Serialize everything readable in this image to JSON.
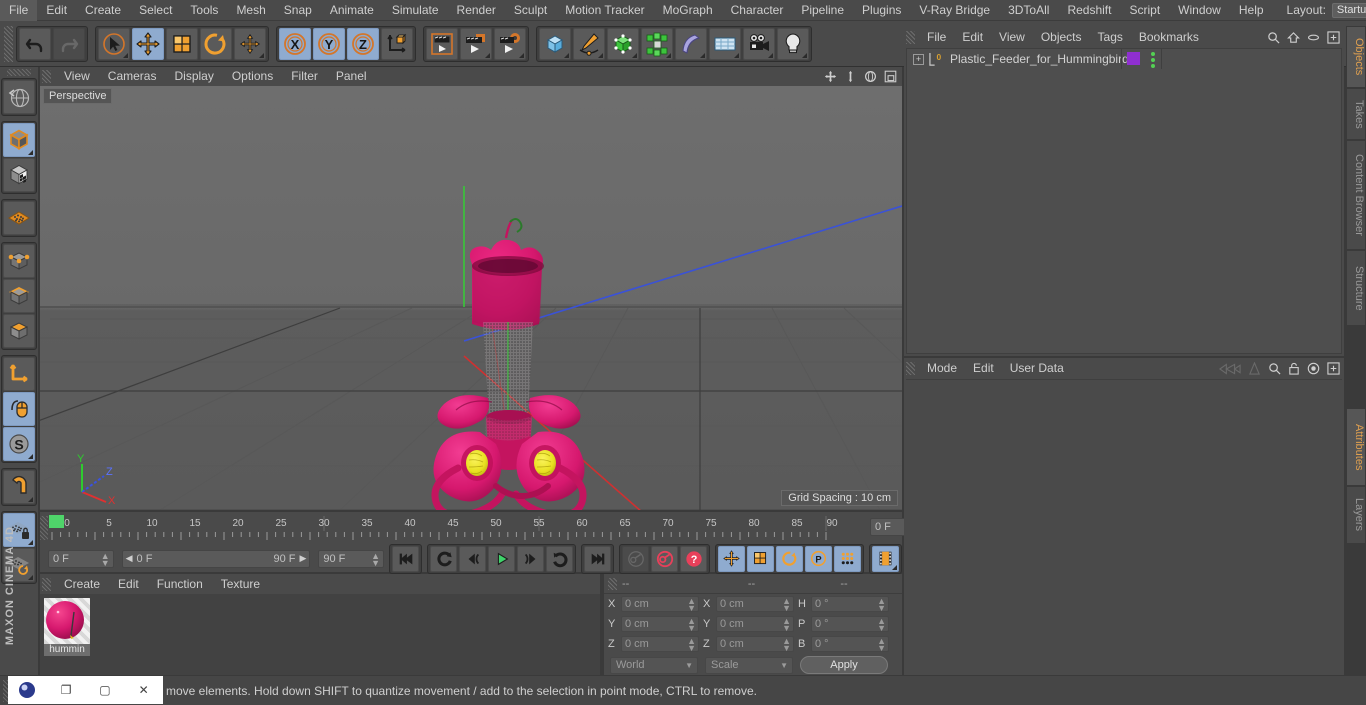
{
  "app": {
    "brand_line1": "MAXON",
    "brand_line2": "CINEMA 4D"
  },
  "menubar": {
    "items": [
      "File",
      "Edit",
      "Create",
      "Select",
      "Tools",
      "Mesh",
      "Snap",
      "Animate",
      "Simulate",
      "Render",
      "Sculpt",
      "Motion Tracker",
      "MoGraph",
      "Character",
      "Pipeline",
      "Plugins",
      "V-Ray Bridge",
      "3DToAll",
      "Redshift",
      "Script",
      "Window",
      "Help"
    ],
    "layout_label": "Layout:",
    "layout_value": "Startup",
    "right_icons": [
      "search-icon"
    ]
  },
  "toolbar": {
    "undo": "undo-icon",
    "redo": "redo-icon",
    "select": "live-selection-icon",
    "move": "move-tool-icon",
    "scale": "scale-tool-icon",
    "rotate": "rotate-tool-icon",
    "move2": "move-axis-icon",
    "axis_x": "X",
    "axis_y": "Y",
    "axis_z": "Z",
    "world_axis": "world-coordinate-icon",
    "render_view": "render-view-icon",
    "render_region": "render-region-icon",
    "render_settings": "render-settings-icon",
    "cube": "cube-primitive-icon",
    "spline": "spline-pen-icon",
    "nurbs": "generator-icon",
    "array": "mograph-array-icon",
    "deformer": "bend-deformer-icon",
    "scene": "floor-scene-icon",
    "camera": "camera-icon",
    "light": "light-icon"
  },
  "lefttool": {
    "items": [
      "undo-view-icon",
      "model-mode-icon",
      "texture-mode-icon",
      "points-mode-icon",
      "edges-mode-icon",
      "polygons-mode-icon",
      "object-axis-icon",
      "world-object-icon",
      "enable-axis-icon",
      "snap-icon",
      "magnet-icon",
      "workplane-lock-icon",
      "workplane-icon"
    ]
  },
  "viewport": {
    "menu": [
      "View",
      "Cameras",
      "Display",
      "Options",
      "Filter",
      "Panel"
    ],
    "label": "Perspective",
    "grid_spacing": "Grid Spacing : 10 cm",
    "icons": [
      "pan-view-icon",
      "dolly-view-icon",
      "rotate-view-icon",
      "maximize-view-icon"
    ],
    "axis": {
      "x": "X",
      "y": "Y",
      "z": "Z"
    }
  },
  "timeline": {
    "ticks": [
      "0",
      "5",
      "10",
      "15",
      "20",
      "25",
      "30",
      "35",
      "40",
      "45",
      "50",
      "55",
      "60",
      "65",
      "70",
      "75",
      "80",
      "85",
      "90"
    ],
    "current_frame": "0 F",
    "range_start": "0 F",
    "range_end": "90 F",
    "end_frame": "90 F",
    "preview_frame": "0 F",
    "controls": [
      "go-to-start-icon",
      "play-backwards-icon",
      "step-back-icon",
      "play-forward-icon",
      "step-forward-icon",
      "play-loop-icon",
      "go-to-end-icon"
    ],
    "record_controls": [
      "record-key-icon",
      "autokeying-icon",
      "keyframe-selection-icon"
    ],
    "key_toggles": [
      "position-key-icon",
      "scale-key-icon",
      "rotation-key-icon",
      "param-key-icon",
      "point-level-anim-icon"
    ],
    "timeline_toggle": "animation-layer-icon"
  },
  "material_manager": {
    "menu": [
      "Create",
      "Edit",
      "Function",
      "Texture"
    ],
    "materials": [
      {
        "name": "hummin",
        "color": "#d6186e"
      }
    ]
  },
  "coordinates": {
    "headers": [
      "--",
      "--",
      "--"
    ],
    "position": {
      "label_x": "X",
      "label_y": "Y",
      "label_z": "Z",
      "x": "0 cm",
      "y": "0 cm",
      "z": "0 cm"
    },
    "size": {
      "label_x": "X",
      "label_y": "Y",
      "label_z": "Z",
      "x": "0 cm",
      "y": "0 cm",
      "z": "0 cm"
    },
    "rotation": {
      "label_h": "H",
      "label_p": "P",
      "label_b": "B",
      "h": "0 °",
      "p": "0 °",
      "b": "0 °"
    },
    "system": "World",
    "mode": "Scale",
    "apply": "Apply"
  },
  "object_manager": {
    "menu": [
      "File",
      "Edit",
      "View",
      "Objects",
      "Tags",
      "Bookmarks"
    ],
    "icons": [
      "search-icon",
      "home-icon",
      "ellipse-icon",
      "expand-icon"
    ],
    "objects": [
      {
        "name": "Plastic_Feeder_for_Hummingbird",
        "layer": "0",
        "material_color": "#8f2fd0"
      }
    ]
  },
  "attribute_manager": {
    "menu": [
      "Mode",
      "Edit",
      "User Data"
    ],
    "icons": [
      "back-nav-icon",
      "forward-nav-icon",
      "search-icon",
      "lock-icon",
      "target-icon",
      "expand-icon"
    ]
  },
  "vertical_tabs": {
    "top": [
      "Objects",
      "Takes",
      "Content Browser",
      "Structure"
    ],
    "bottom": [
      "Attributes",
      "Layers"
    ],
    "active_top": "Objects",
    "active_bottom": "Attributes"
  },
  "statusbar": {
    "text": "move elements. Hold down SHIFT to quantize movement / add to the selection in point mode, CTRL to remove."
  },
  "window_controls": {
    "items": [
      "restore-icon",
      "maximize-icon",
      "close-icon"
    ],
    "glyphs": [
      "❐",
      "▢",
      "✕"
    ]
  },
  "colors": {
    "accent": "#e0a050",
    "selected_button": "#8fabcf",
    "model_magenta": "#d6186e",
    "model_yellow": "#e8e020",
    "panel_bg": "#4a4a4a",
    "viewport_bg": "#646464"
  }
}
